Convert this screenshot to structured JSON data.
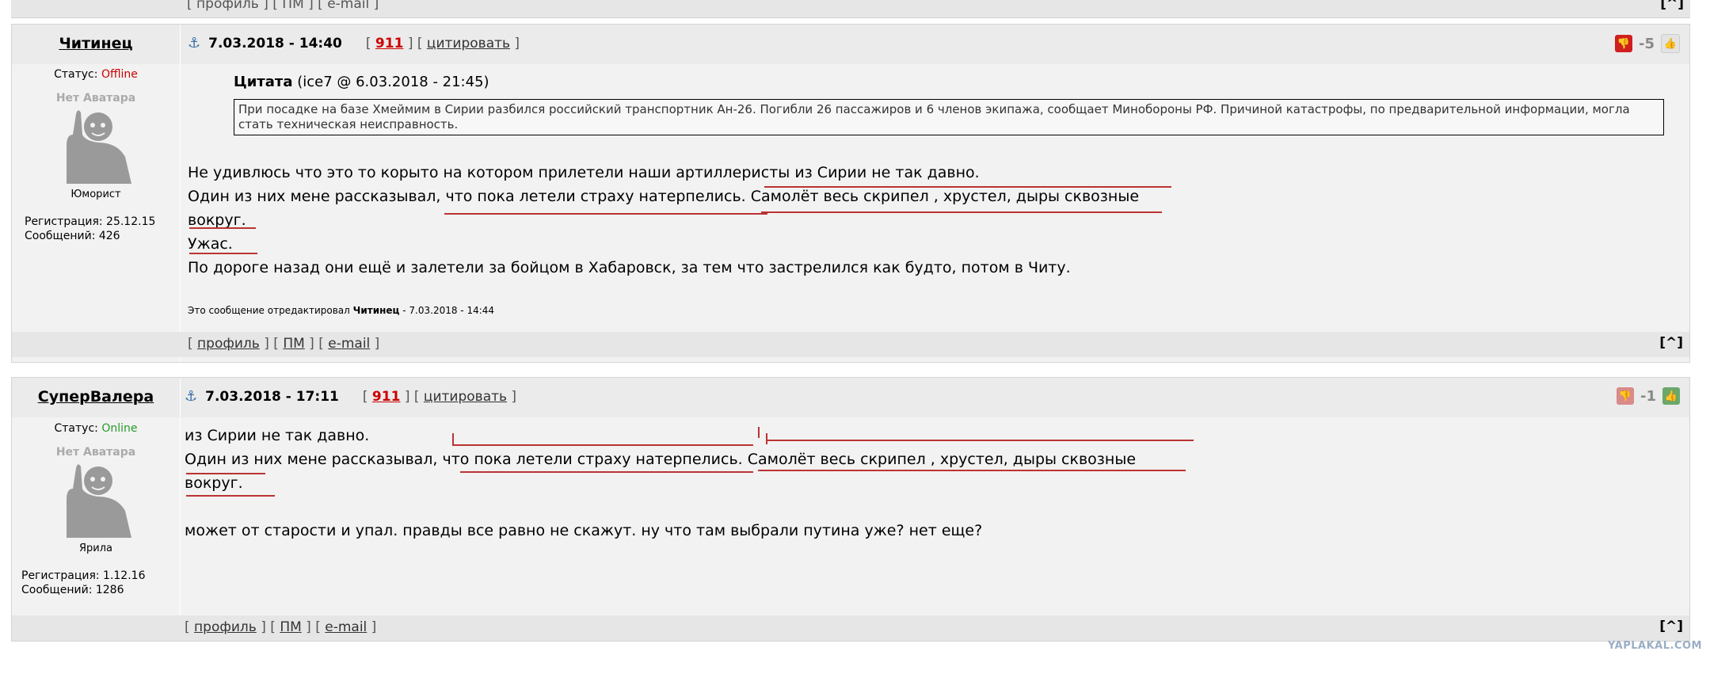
{
  "prev_footer": {
    "links": "[ профиль ] [ ПМ ] [ e-mail ]",
    "up": "[^]"
  },
  "post1": {
    "author": "Читинец",
    "date": "7.03.2018 - 14:40",
    "link911": "911",
    "quote_link": "цитировать",
    "rating": "-5",
    "status_label": "Статус:",
    "status": "Offline",
    "avatar_text": "Нет Аватара",
    "rank": "Юморист",
    "registration": "Регистрация: 25.12.15",
    "messages": "Сообщений: 426",
    "quote_title": "Цитата",
    "quote_meta": "(ice7 @ 6.03.2018 - 21:45)",
    "quote_text": "При посадке на базе Хмеймим в Сирии разбился российский транспортник Ан-26. Погибли 26 пассажиров и 6 членов экипажа, сообщает Минобороны РФ. Причиной катастрофы, по предварительной информации, могла стать техническая неисправность.",
    "lines": [
      "Не удивлюсь что это то корыто на котором прилетели наши артиллеристы из Сирии не так давно.",
      "Один из них мене рассказывал, что пока летели страху натерпелись. Самолёт весь скрипел , хрустел, дыры сквозные",
      "вокруг.",
      "Ужас.",
      "По дороге назад они ещё и залетели за бойцом в Хабаровск, за тем что застрелился как будто, потом в Читу."
    ],
    "edit_prefix": "Это сообщение отредактировал",
    "edit_author": "Читинец",
    "edit_time": "- 7.03.2018 - 14:44",
    "footer_profile": "профиль",
    "footer_pm": "ПМ",
    "footer_email": "e-mail",
    "up": "[^]"
  },
  "post2": {
    "author": "СуперВалера",
    "date": "7.03.2018 - 17:11",
    "link911": "911",
    "quote_link": "цитировать",
    "rating": "-1",
    "status_label": "Статус:",
    "status": "Online",
    "avatar_text": "Нет Аватара",
    "rank": "Ярила",
    "registration": "Регистрация: 1.12.16",
    "messages": "Сообщений: 1286",
    "lines": [
      "из Сирии не так давно.",
      "Один из них мене рассказывал, что пока летели страху натерпелись. Самолёт весь скрипел , хрустел, дыры сквозные",
      "вокруг.",
      "",
      "может от старости и упал. правды все равно не скажут. ну что там выбрали путина уже? нет еще?"
    ],
    "footer_profile": "профиль",
    "footer_pm": "ПМ",
    "footer_email": "e-mail",
    "up": "[^]"
  },
  "watermark": "YAPLAKAL.COM",
  "colors": {
    "accent_red": "#c00000",
    "online_green": "#2a9a2a",
    "underline_red": "#b33333"
  }
}
